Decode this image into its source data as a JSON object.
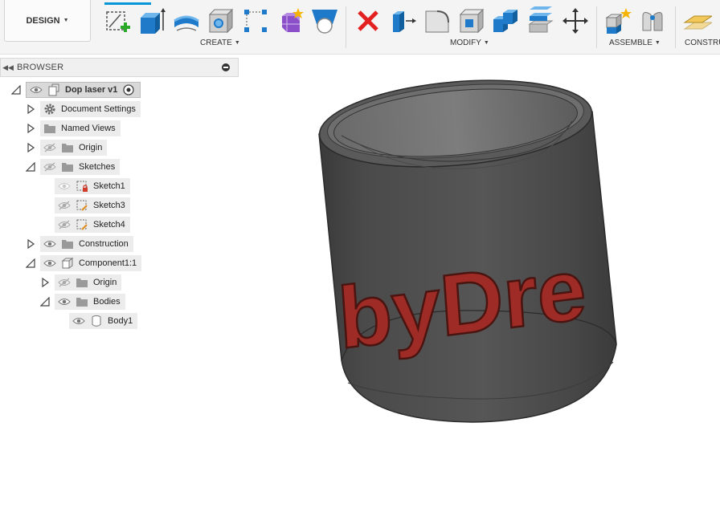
{
  "toolbar": {
    "workspace": "DESIGN",
    "groups": {
      "create": "CREATE",
      "modify": "MODIFY",
      "assemble": "ASSEMBLE",
      "construct": "CONSTRU"
    },
    "icons": {
      "create": [
        "create-sketch-icon",
        "extrude-icon",
        "revolve-icon",
        "hole-icon",
        "rectangular-pattern-icon",
        "create-form-icon",
        "derive-icon"
      ],
      "modify": [
        "delete-icon",
        "press-pull-icon",
        "fillet-icon",
        "shell-icon",
        "combine-icon",
        "offset-face-icon",
        "move-copy-icon"
      ],
      "assemble": [
        "new-component-icon",
        "joint-icon"
      ]
    }
  },
  "browser": {
    "title": "BROWSER",
    "items": [
      {
        "label": "Dop laser v1"
      },
      {
        "label": "Document Settings"
      },
      {
        "label": "Named Views"
      },
      {
        "label": "Origin"
      },
      {
        "label": "Sketches"
      },
      {
        "label": "Sketch1"
      },
      {
        "label": "Sketch3"
      },
      {
        "label": "Sketch4"
      },
      {
        "label": "Construction"
      },
      {
        "label": "Component1:1"
      },
      {
        "label": "Origin"
      },
      {
        "label": "Bodies"
      },
      {
        "label": "Body1"
      }
    ]
  },
  "viewport": {
    "model_text": "ibyDre",
    "colors": {
      "body": "#4a4a4a",
      "text": "#9e2b25",
      "accent": "#0696d7"
    }
  }
}
